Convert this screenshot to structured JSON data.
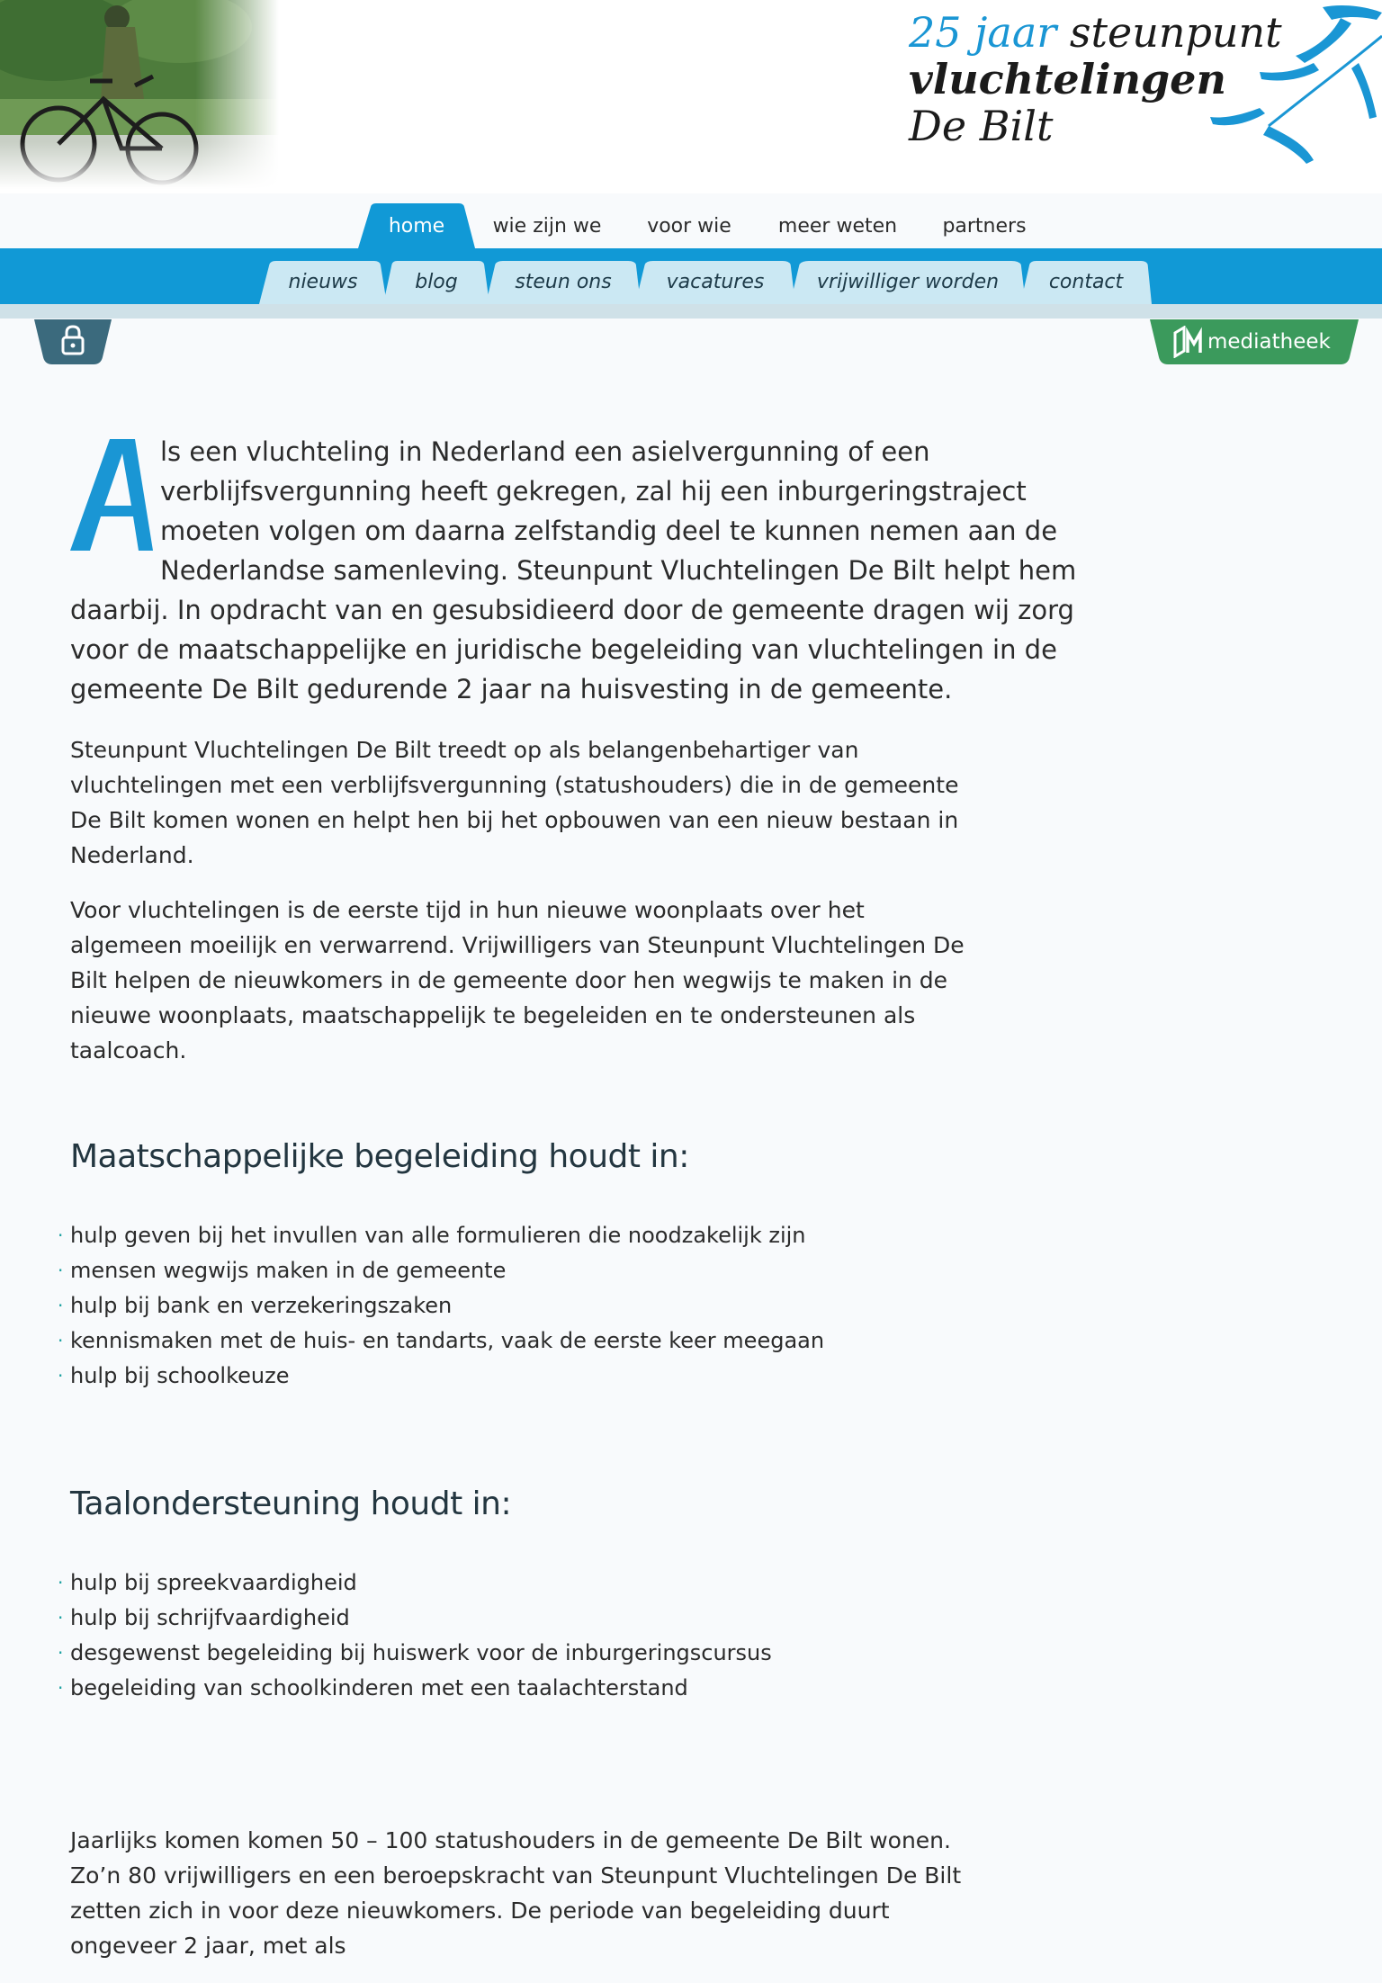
{
  "header": {
    "logo": {
      "line1_blue": "25 jaar",
      "line1_dark": "steunpunt",
      "line2": "vluchtelingen",
      "line3": "De Bilt"
    }
  },
  "main_nav": [
    {
      "label": "home",
      "active": true
    },
    {
      "label": "wie zijn we",
      "active": false
    },
    {
      "label": "voor wie",
      "active": false
    },
    {
      "label": "meer weten",
      "active": false
    },
    {
      "label": "partners",
      "active": false
    }
  ],
  "sub_nav": [
    {
      "label": "nieuws"
    },
    {
      "label": "blog"
    },
    {
      "label": "steun ons"
    },
    {
      "label": "vacatures"
    },
    {
      "label": "vrijwilliger worden"
    },
    {
      "label": "contact"
    }
  ],
  "buttons": {
    "lock_icon": "lock-icon",
    "mediatheek_label": "mediatheek",
    "mediatheek_icon": "mediatheek-icon"
  },
  "colors": {
    "brand_blue": "#1199d6",
    "sub_tab": "#cbe8f3",
    "lock_btn": "#3b6a7d",
    "media_btn": "#3b9a5c"
  },
  "content": {
    "dropcap": "A",
    "lead": "ls een vluchteling in Nederland een asielvergunning of een verblijfsvergunning heeft gekregen, zal hij een inburgeringstraject moeten volgen om daarna zelfstandig deel te kunnen nemen aan de Nederlandse samenleving. Steunpunt Vluchtelingen De Bilt helpt hem daarbij. In opdracht van en gesubsidieerd door de gemeente dragen wij zorg voor de maatschappelijke en juridische begeleiding van vluchtelingen in de gemeente De Bilt gedurende 2 jaar na huisvesting in de gemeente.",
    "para1": "Steunpunt Vluchtelingen De Bilt treedt op als belangenbehartiger van vluchtelingen met een verblijfsvergunning (statushouders) die in de gemeente De Bilt komen wonen en helpt hen bij het opbouwen van een nieuw bestaan in Nederland.",
    "para2": "Voor vluchtelingen is de eerste tijd in hun nieuwe woonplaats over het algemeen moeilijk en verwarrend. Vrijwilligers van Steunpunt Vluchtelingen De Bilt helpen de nieuwkomers in de gemeente door hen wegwijs te maken in de nieuwe woonplaats, maatschappelijk te begeleiden en te ondersteunen als taalcoach.",
    "heading1": "Maatschappelijke begeleiding houdt in:",
    "list1": [
      "hulp geven bij het invullen van alle formulieren die noodzakelijk zijn",
      "mensen wegwijs maken in de gemeente",
      "hulp bij bank en verzekeringszaken",
      "kennismaken met de huis- en tandarts, vaak de eerste keer meegaan",
      "hulp bij schoolkeuze"
    ],
    "heading2": "Taalondersteuning houdt in:",
    "list2": [
      "hulp bij spreekvaardigheid",
      "hulp bij schrijfvaardigheid",
      "desgewenst begeleiding bij huiswerk voor de inburgeringscursus",
      "begeleiding van schoolkinderen met een taalachterstand"
    ],
    "para3": "Jaarlijks komen komen 50 – 100 statushouders in de gemeente De Bilt wonen. Zo’n 80 vrijwilligers en een beroepskracht van Steunpunt Vluchtelingen De Bilt zetten zich in voor deze nieuwkomers. De periode van begeleiding duurt ongeveer 2 jaar, met als"
  }
}
